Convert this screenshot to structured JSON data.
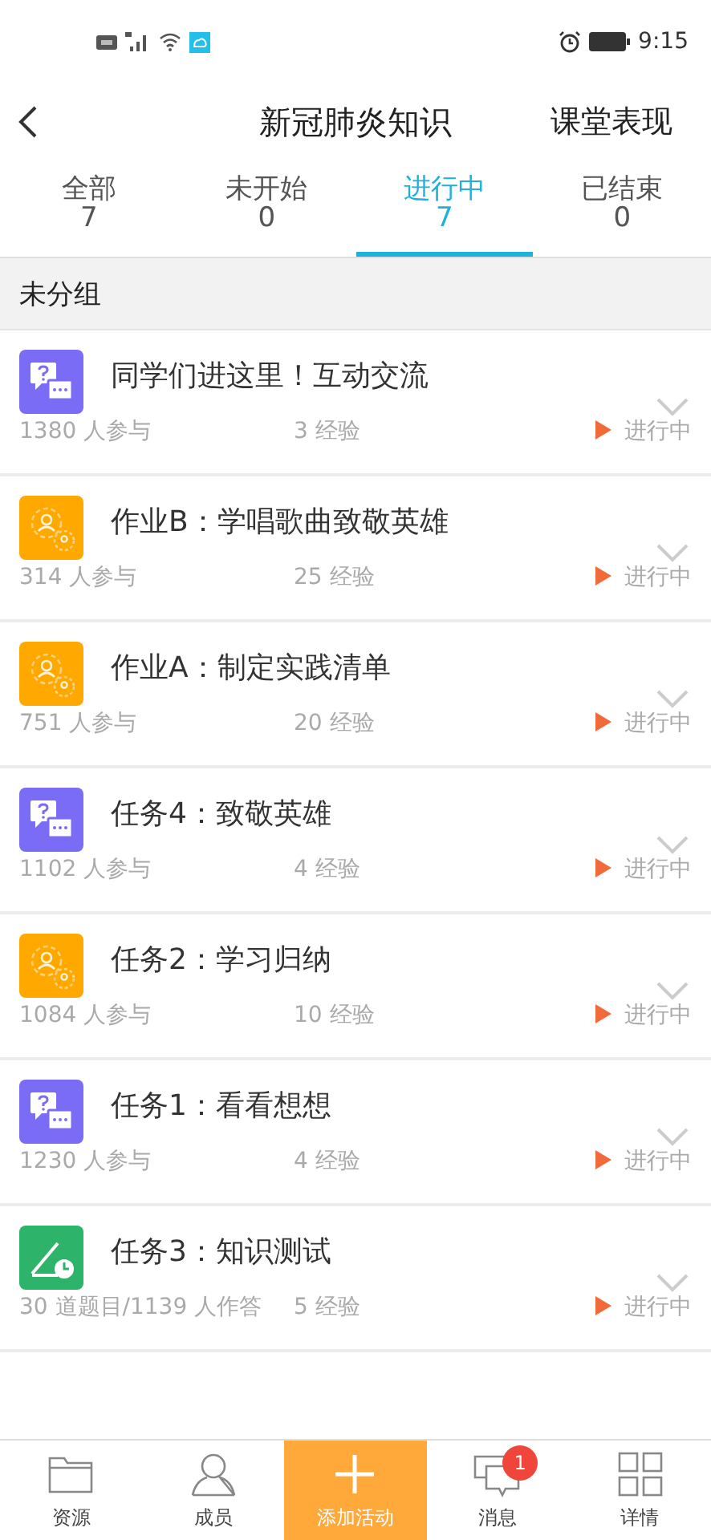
{
  "status_bar": {
    "time": "9:15"
  },
  "header": {
    "title": "新冠肺炎知识",
    "action": "课堂表现"
  },
  "tabs": [
    {
      "label": "全部",
      "count": "7",
      "selected": false
    },
    {
      "label": "未开始",
      "count": "0",
      "selected": false
    },
    {
      "label": "进行中",
      "count": "7",
      "selected": true
    },
    {
      "label": "已结束",
      "count": "0",
      "selected": false
    }
  ],
  "group": {
    "title": "未分组"
  },
  "activities": [
    {
      "kind": "discussion",
      "title": "同学们进这里！互动交流",
      "participants": "1380 人参与",
      "experience": "3 经验",
      "status": "进行中"
    },
    {
      "kind": "group",
      "title": "作业B：学唱歌曲致敬英雄",
      "participants": "314 人参与",
      "experience": "25 经验",
      "status": "进行中"
    },
    {
      "kind": "group",
      "title": "作业A：制定实践清单",
      "participants": "751 人参与",
      "experience": "20 经验",
      "status": "进行中"
    },
    {
      "kind": "discussion",
      "title": "任务4：致敬英雄",
      "participants": "1102 人参与",
      "experience": "4 经验",
      "status": "进行中"
    },
    {
      "kind": "group",
      "title": "任务2：学习归纳",
      "participants": "1084 人参与",
      "experience": "10 经验",
      "status": "进行中"
    },
    {
      "kind": "discussion",
      "title": "任务1：看看想想",
      "participants": "1230 人参与",
      "experience": "4 经验",
      "status": "进行中"
    },
    {
      "kind": "quiz",
      "title": "任务3：知识测试",
      "participants": "30 道题目/1139 人作答",
      "experience": "5 经验",
      "status": "进行中"
    }
  ],
  "bottom_nav": [
    {
      "kind": "folder",
      "label": "资源",
      "selected": false
    },
    {
      "kind": "person",
      "label": "成员",
      "selected": false
    },
    {
      "kind": "add",
      "label": "添加活动",
      "selected": true
    },
    {
      "kind": "chat",
      "label": "消息",
      "selected": false,
      "badge": "1"
    },
    {
      "kind": "grid",
      "label": "详情",
      "selected": false
    }
  ]
}
